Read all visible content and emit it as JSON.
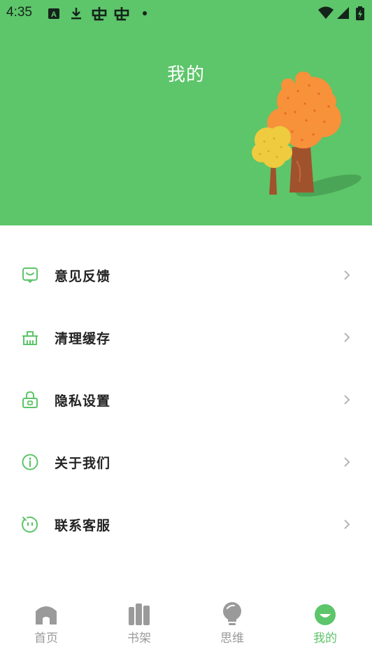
{
  "status_bar": {
    "time": "4:35",
    "icons": [
      "a-notification-icon",
      "download-icon",
      "bug-icon",
      "bug-icon",
      "dot-icon",
      "wifi-icon",
      "cellular-signal-icon",
      "battery-icon"
    ]
  },
  "header": {
    "title": "我的",
    "background_color": "#5dc56a"
  },
  "menu": {
    "items": [
      {
        "label": "意见反馈",
        "icon": "feedback-icon"
      },
      {
        "label": "清理缓存",
        "icon": "clean-cache-icon"
      },
      {
        "label": "隐私设置",
        "icon": "lock-icon"
      },
      {
        "label": "关于我们",
        "icon": "info-icon"
      },
      {
        "label": "联系客服",
        "icon": "customer-service-icon"
      }
    ],
    "accent_color": "#5dc56a"
  },
  "bottom_nav": {
    "items": [
      {
        "label": "首页",
        "icon": "home-icon",
        "active": false
      },
      {
        "label": "书架",
        "icon": "bookshelf-icon",
        "active": false
      },
      {
        "label": "思维",
        "icon": "lightbulb-icon",
        "active": false
      },
      {
        "label": "我的",
        "icon": "profile-icon",
        "active": true
      }
    ],
    "active_color": "#5dc56a",
    "inactive_color": "#9a9a9a"
  }
}
